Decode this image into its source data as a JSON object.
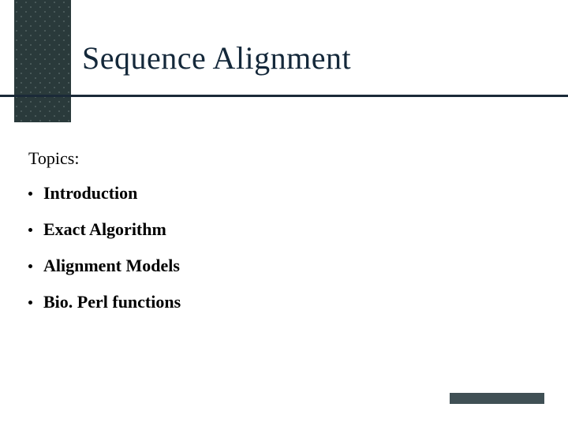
{
  "title": "Sequence Alignment",
  "topics_label": "Topics:",
  "bullets": [
    "Introduction",
    "Exact Algorithm",
    "Alignment Models",
    "Bio. Perl functions"
  ]
}
